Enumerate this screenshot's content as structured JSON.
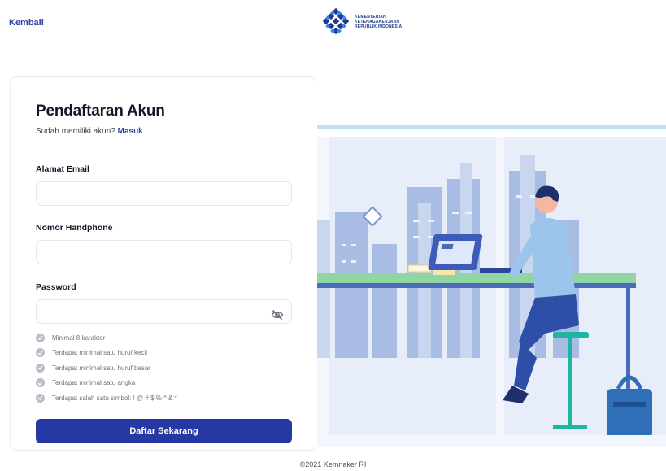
{
  "header": {
    "back_label": "Kembali",
    "logo": {
      "line1": "KEMENTERIAN",
      "line2": "KETENAGAKERJAAN",
      "line3": "REPUBLIK INDONESIA",
      "icon": "kemnaker-logo"
    }
  },
  "form": {
    "title": "Pendaftaran Akun",
    "subtitle_prefix": "Sudah memiliki akun?",
    "login_link": "Masuk",
    "email_label": "Alamat Email",
    "email_value": "",
    "phone_label": "Nomor Handphone",
    "phone_value": "",
    "password_label": "Password",
    "password_value": "",
    "password_toggle_icon": "eye-off-icon",
    "rules": [
      "Minimal 8 karakter",
      "Terdapat minimal satu huruf kecil",
      "Terdapat minimal satu huruf besar",
      "Terdapat minimal satu angka",
      "Terdapat salah satu simbol: ! @ # $ % ^ & *"
    ],
    "submit_label": "Daftar Sekarang"
  },
  "footer": {
    "copyright": "©2021 Kemnaker RI"
  },
  "colors": {
    "accent": "#2638a3",
    "link": "#2b3ea6",
    "rule_check": "#b8bec8"
  }
}
